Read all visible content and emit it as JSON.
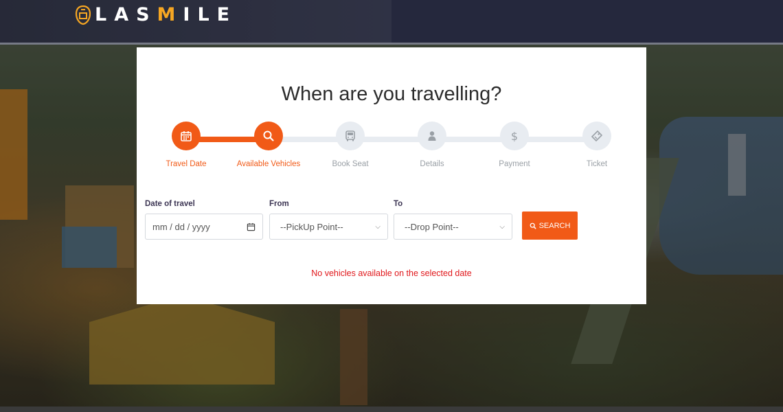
{
  "header": {
    "brand_prefix": "LAS",
    "brand_accent": "M",
    "brand_suffix": "ILE",
    "brand_color": "#ffffff",
    "brand_accent_color": "#f5a623"
  },
  "card": {
    "title": "When are you travelling?"
  },
  "steps": [
    {
      "label": "Travel Date",
      "icon": "calendar-icon",
      "state": "done"
    },
    {
      "label": "Available Vehicles",
      "icon": "search-icon",
      "state": "current"
    },
    {
      "label": "Book Seat",
      "icon": "bus-icon",
      "state": "pending"
    },
    {
      "label": "Details",
      "icon": "user-icon",
      "state": "pending"
    },
    {
      "label": "Payment",
      "icon": "dollar-icon",
      "state": "pending"
    },
    {
      "label": "Ticket",
      "icon": "ticket-icon",
      "state": "pending"
    }
  ],
  "form": {
    "date_label": "Date of travel",
    "date_placeholder": "mm / dd / yyyy",
    "from_label": "From",
    "from_value": "--PickUp Point--",
    "to_label": "To",
    "to_value": "--Drop Point--",
    "search_label": "SEARCH"
  },
  "message": "No vehicles available on the selected date",
  "colors": {
    "accent": "#f15a17",
    "inactive": "#e8ecf1",
    "error": "#e0161a"
  }
}
